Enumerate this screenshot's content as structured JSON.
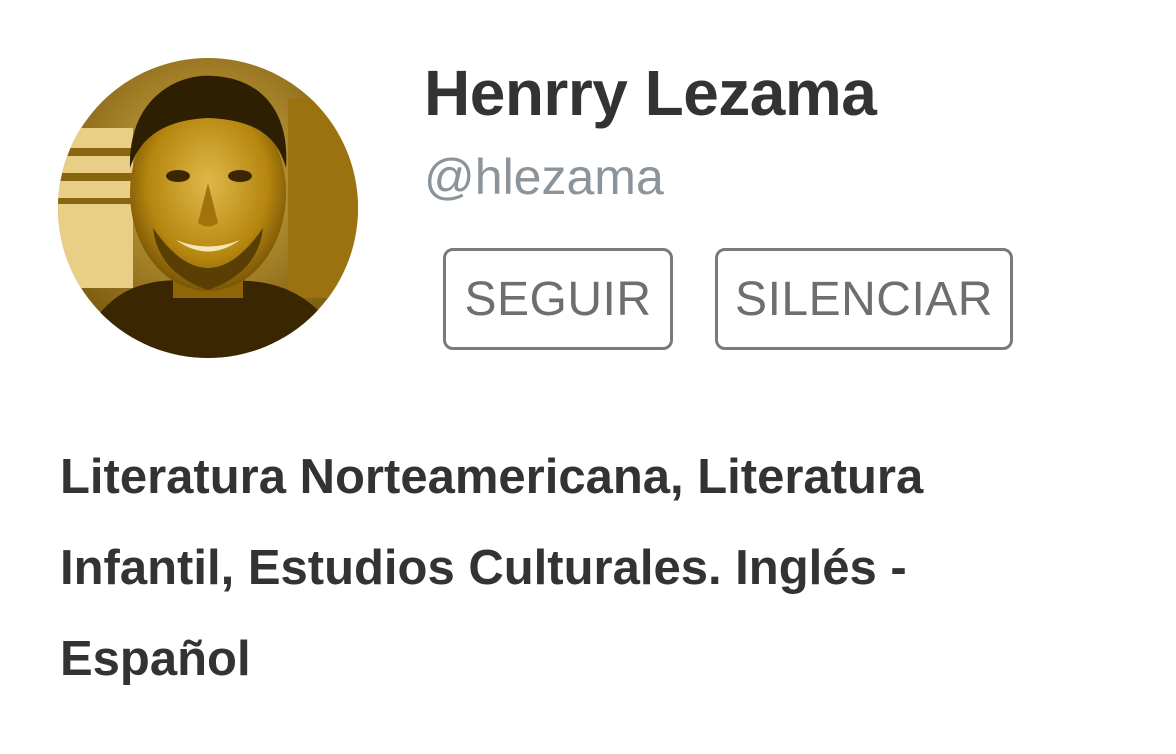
{
  "profile": {
    "name": "Henrry Lezama",
    "handle": "@hlezama",
    "bio": "Literatura Norteamericana, Literatura Infantil, Estudios Culturales. Inglés - Español"
  },
  "actions": {
    "follow_label": "SEGUIR",
    "mute_label": "SILENCIAR"
  },
  "colors": {
    "name_text": "#333333",
    "handle_text": "#8a949a",
    "button_border": "#7a7a7a",
    "button_text": "#6e6e6e",
    "avatar_tint": "#b8860b"
  },
  "icons": {
    "avatar": "user-avatar-photo"
  }
}
